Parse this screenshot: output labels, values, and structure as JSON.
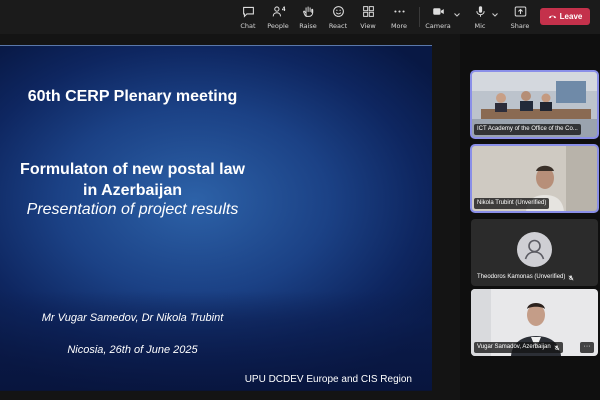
{
  "toolbar": {
    "chat": "Chat",
    "people": "People",
    "people_count": "4",
    "raise": "Raise",
    "react": "React",
    "view": "View",
    "more": "More",
    "camera": "Camera",
    "mic": "Mic",
    "share": "Share",
    "leave": "Leave",
    "leave_color": "#c4314b"
  },
  "slide": {
    "title": "60th CERP Plenary meeting",
    "heading_line1": "Formulaton of new postal law",
    "heading_line2": "in Azerbaijan",
    "subheading": "Presentation of project results",
    "authors": "Mr Vugar Samedov, Dr Nikola Trubint",
    "place_date": "Nicosia, 26th of June 2025",
    "footer": "UPU DCDEV Europe and CIS Region"
  },
  "participants": [
    {
      "name": "ICT Academy of the Office of the Co...",
      "active": true
    },
    {
      "name": "Nikola Trubint (Unverified)",
      "active": true
    },
    {
      "name": "Theodoros Kamonas (Unverified)",
      "mic_muted": true,
      "icon": "person-avatar-icon"
    },
    {
      "name": "Vugar Samadov, Azerbaijan",
      "mic_muted": true
    }
  ]
}
